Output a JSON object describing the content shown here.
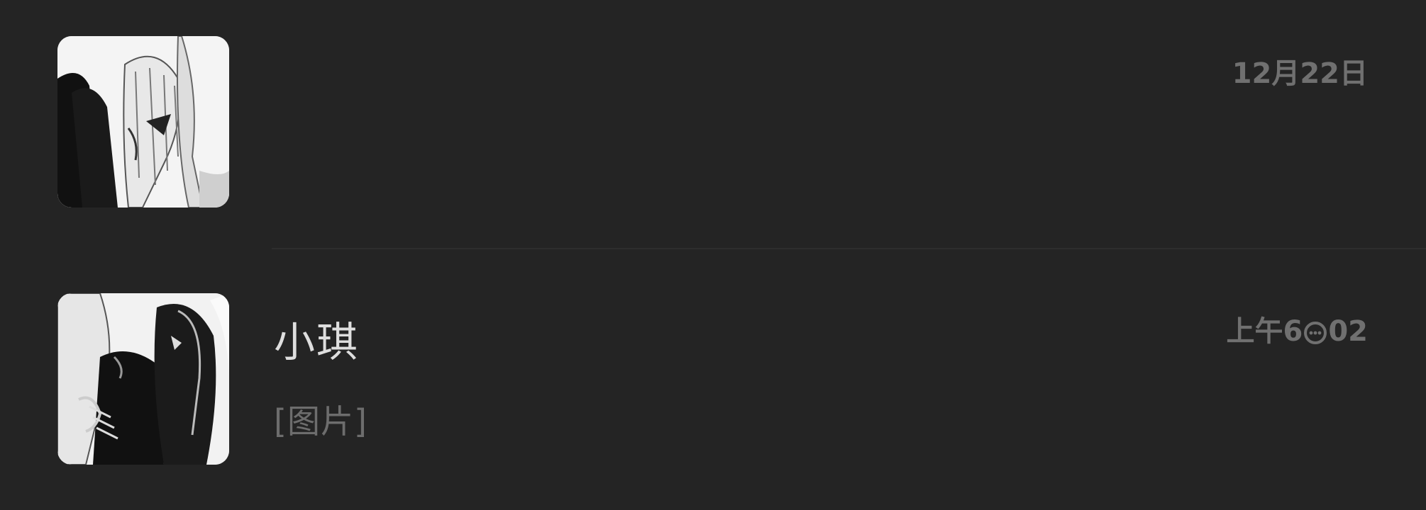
{
  "conversations": [
    {
      "name": "",
      "preview": "",
      "time": "12月22日",
      "avatar_icon": "avatar-image"
    },
    {
      "name": "小琪",
      "preview": "[图片]",
      "time_prefix": "上午6",
      "time_icon": "chat-bubble-icon",
      "time_suffix": "02",
      "avatar_icon": "avatar-image"
    }
  ],
  "colors": {
    "background": "#242424",
    "name_text": "#dedede",
    "secondary_text": "#6d6d6d",
    "divider": "#2e2e2e"
  }
}
